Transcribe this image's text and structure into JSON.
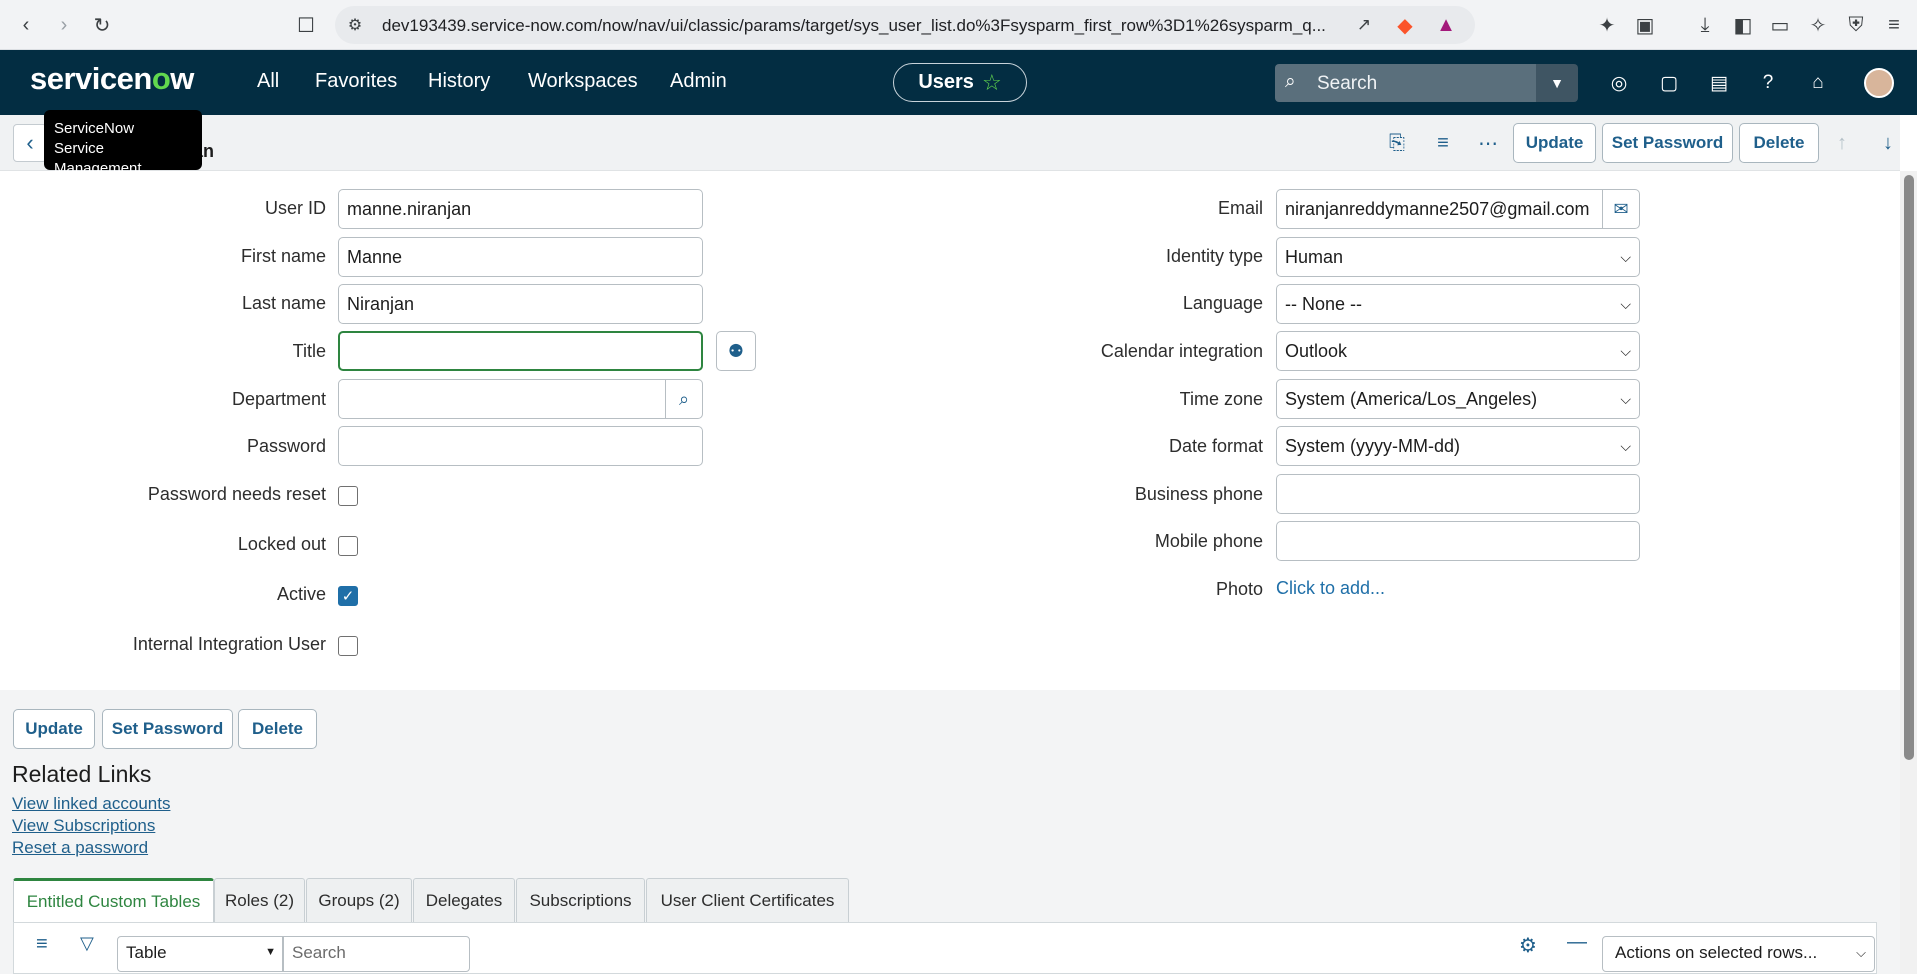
{
  "browser": {
    "url": "dev193439.service-now.com/now/nav/ui/classic/params/target/sys_user_list.do%3Fsysparm_first_row%3D1%26sysparm_q..."
  },
  "header": {
    "logo": "servicenow",
    "nav": [
      "All",
      "Favorites",
      "History",
      "Workspaces",
      "Admin"
    ],
    "context_pill": "Users",
    "search_placeholder": "Search"
  },
  "tooltip": {
    "line1": "ServiceNow",
    "line2": "Service Management"
  },
  "form_header": {
    "title_fragment": "jan",
    "buttons": {
      "update": "Update",
      "set_password": "Set Password",
      "delete": "Delete"
    }
  },
  "form": {
    "left": {
      "user_id": {
        "label": "User ID",
        "value": "manne.niranjan"
      },
      "first_name": {
        "label": "First name",
        "value": "Manne"
      },
      "last_name": {
        "label": "Last name",
        "value": "Niranjan"
      },
      "title": {
        "label": "Title",
        "value": ""
      },
      "department": {
        "label": "Department",
        "value": ""
      },
      "password": {
        "label": "Password",
        "value": ""
      },
      "password_needs_reset": {
        "label": "Password needs reset",
        "checked": false
      },
      "locked_out": {
        "label": "Locked out",
        "checked": false
      },
      "active": {
        "label": "Active",
        "checked": true
      },
      "internal_integration_user": {
        "label": "Internal Integration User",
        "checked": false
      }
    },
    "right": {
      "email": {
        "label": "Email",
        "value": "niranjanreddymanne2507@gmail.com"
      },
      "identity_type": {
        "label": "Identity type",
        "value": "Human"
      },
      "language": {
        "label": "Language",
        "value": "-- None --"
      },
      "calendar_integration": {
        "label": "Calendar integration",
        "value": "Outlook"
      },
      "time_zone": {
        "label": "Time zone",
        "value": "System (America/Los_Angeles)"
      },
      "date_format": {
        "label": "Date format",
        "value": "System (yyyy-MM-dd)"
      },
      "business_phone": {
        "label": "Business phone",
        "value": ""
      },
      "mobile_phone": {
        "label": "Mobile phone",
        "value": ""
      },
      "photo": {
        "label": "Photo",
        "link": "Click to add..."
      }
    }
  },
  "bottom_buttons": {
    "update": "Update",
    "set_password": "Set Password",
    "delete": "Delete"
  },
  "related_links": {
    "title": "Related Links",
    "links": [
      "View linked accounts",
      "View Subscriptions",
      "Reset a password"
    ]
  },
  "tabs": [
    "Entitled Custom Tables",
    "Roles (2)",
    "Groups (2)",
    "Delegates",
    "Subscriptions",
    "User Client Certificates"
  ],
  "list_bar": {
    "view_select": "Table",
    "search_placeholder": "Search",
    "actions_select": "Actions on selected rows..."
  }
}
